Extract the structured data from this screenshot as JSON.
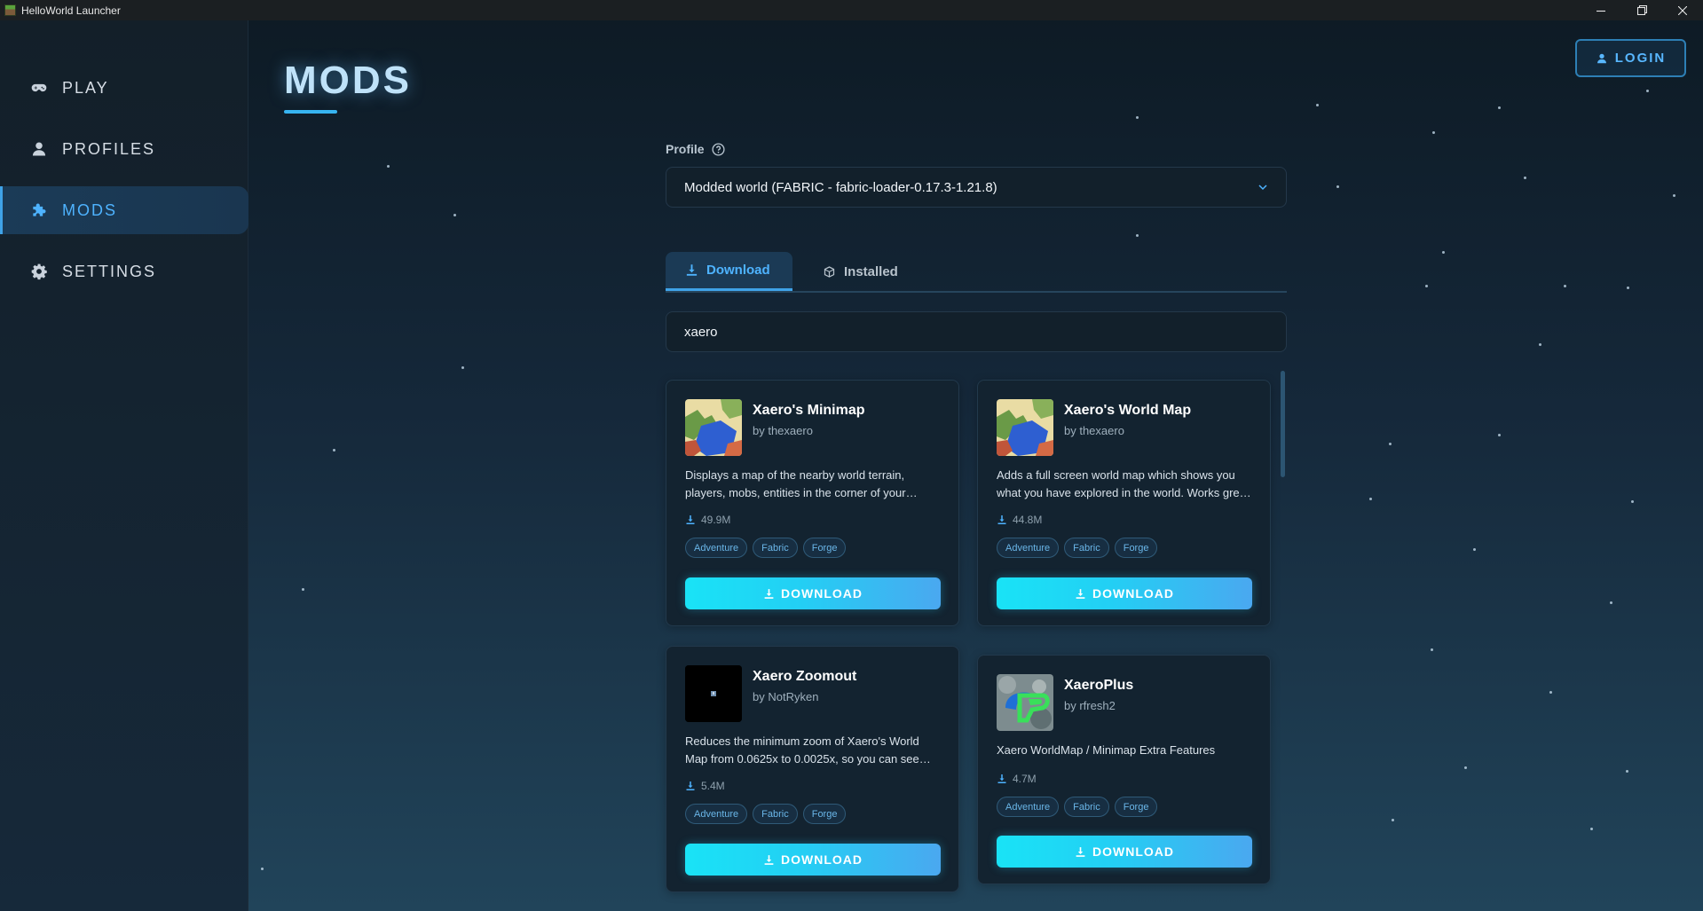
{
  "window": {
    "title": "HelloWorld Launcher"
  },
  "sidebar": {
    "items": [
      {
        "label": "PLAY",
        "icon": "gamepad-icon",
        "active": false
      },
      {
        "label": "PROFILES",
        "icon": "user-icon",
        "active": false
      },
      {
        "label": "MODS",
        "icon": "puzzle-icon",
        "active": true
      },
      {
        "label": "SETTINGS",
        "icon": "gear-icon",
        "active": false
      }
    ]
  },
  "header": {
    "title": "MODS",
    "login_label": "LOGIN"
  },
  "profile": {
    "label": "Profile",
    "selected": "Modded world (FABRIC - fabric-loader-0.17.3-1.21.8)"
  },
  "tabs": {
    "download": "Download",
    "installed": "Installed"
  },
  "search": {
    "value": "xaero"
  },
  "mods": [
    {
      "title": "Xaero's Minimap",
      "author": "by thexaero",
      "description": "Displays a map of the nearby world terrain, players, mobs, entities in the corner of your screen. Lets you create waypoints which help you find the locations you've marked.",
      "downloads": "49.9M",
      "tags": [
        "Adventure",
        "Fabric",
        "Forge"
      ],
      "button": "DOWNLOAD",
      "thumb": "map-thumbnail"
    },
    {
      "title": "Xaero's World Map",
      "author": "by thexaero",
      "description": "Adds a full screen world map which shows you what you have explored in the world. Works great with Xaero's Minimap.",
      "downloads": "44.8M",
      "tags": [
        "Adventure",
        "Fabric",
        "Forge"
      ],
      "button": "DOWNLOAD",
      "thumb": "map-thumbnail"
    },
    {
      "title": "Xaero Zoomout",
      "author": "by NotRyken",
      "description": "Reduces the minimum zoom of Xaero's World Map from 0.0625x to 0.0025x, so you can see more of the world at once.",
      "downloads": "5.4M",
      "tags": [
        "Adventure",
        "Fabric",
        "Forge"
      ],
      "button": "DOWNLOAD",
      "thumb": "dark-thumbnail"
    },
    {
      "title": "XaeroPlus",
      "author": "by rfresh2",
      "description": "Xaero WorldMap / Minimap Extra Features",
      "downloads": "4.7M",
      "tags": [
        "Adventure",
        "Fabric",
        "Forge"
      ],
      "button": "DOWNLOAD",
      "thumb": "xaeroplus-thumbnail"
    }
  ],
  "colors": {
    "accent": "#4eb3ff",
    "button_start": "#19e3f6",
    "button_end": "#4aa8f0",
    "background": "#15283a"
  }
}
